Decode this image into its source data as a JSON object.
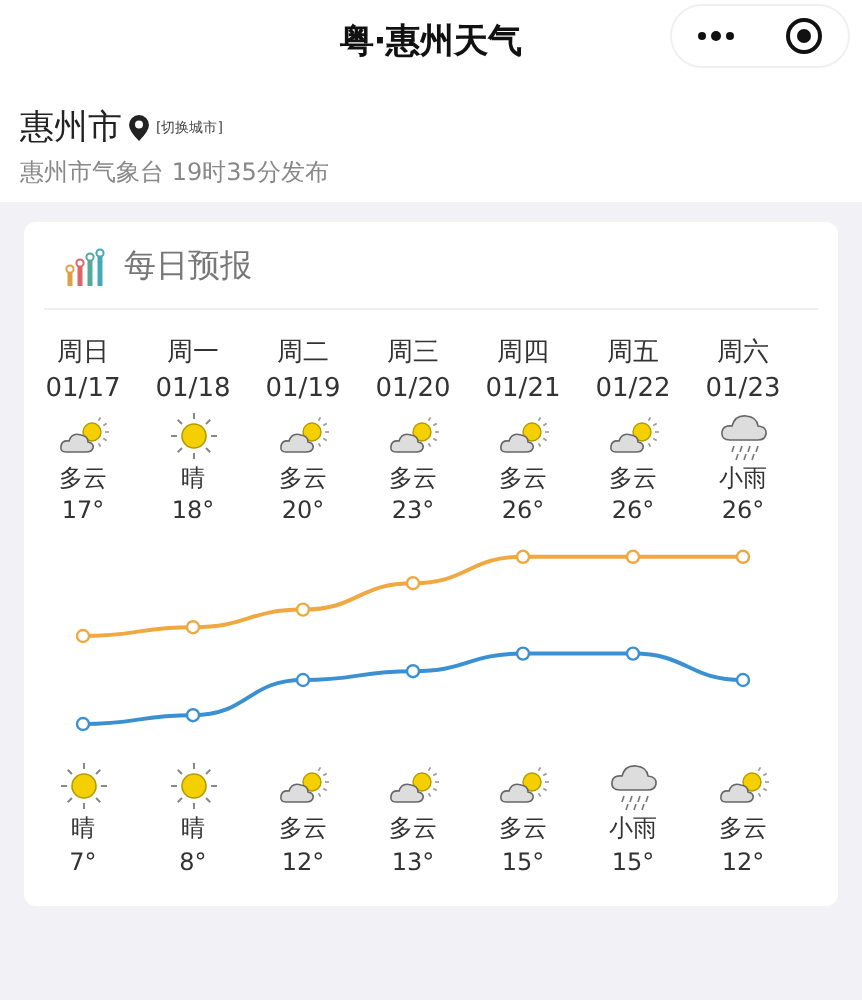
{
  "title": "粤·惠州天气",
  "location": {
    "city": "惠州市",
    "switch_label": "[切换城市]",
    "issued": "惠州市气象台 19时35分发布"
  },
  "forecast": {
    "heading": "每日预报",
    "days": [
      {
        "day": "周日",
        "date": "01/17",
        "daytime": {
          "kind": "cloudy",
          "weather": "多云",
          "temp": "17°"
        },
        "night": {
          "kind": "sunny",
          "weather": "晴",
          "temp": "7°"
        }
      },
      {
        "day": "周一",
        "date": "01/18",
        "daytime": {
          "kind": "sunny",
          "weather": "晴",
          "temp": "18°"
        },
        "night": {
          "kind": "sunny",
          "weather": "晴",
          "temp": "8°"
        }
      },
      {
        "day": "周二",
        "date": "01/19",
        "daytime": {
          "kind": "cloudy",
          "weather": "多云",
          "temp": "20°"
        },
        "night": {
          "kind": "cloudy",
          "weather": "多云",
          "temp": "12°"
        }
      },
      {
        "day": "周三",
        "date": "01/20",
        "daytime": {
          "kind": "cloudy",
          "weather": "多云",
          "temp": "23°"
        },
        "night": {
          "kind": "cloudy",
          "weather": "多云",
          "temp": "13°"
        }
      },
      {
        "day": "周四",
        "date": "01/21",
        "daytime": {
          "kind": "cloudy",
          "weather": "多云",
          "temp": "26°"
        },
        "night": {
          "kind": "cloudy",
          "weather": "多云",
          "temp": "15°"
        }
      },
      {
        "day": "周五",
        "date": "01/22",
        "daytime": {
          "kind": "cloudy",
          "weather": "多云",
          "temp": "26°"
        },
        "night": {
          "kind": "rain",
          "weather": "小雨",
          "temp": "15°"
        }
      },
      {
        "day": "周六",
        "date": "01/23",
        "daytime": {
          "kind": "rain",
          "weather": "小雨",
          "temp": "26°"
        },
        "night": {
          "kind": "cloudy",
          "weather": "多云",
          "temp": "12°"
        }
      }
    ]
  }
}
